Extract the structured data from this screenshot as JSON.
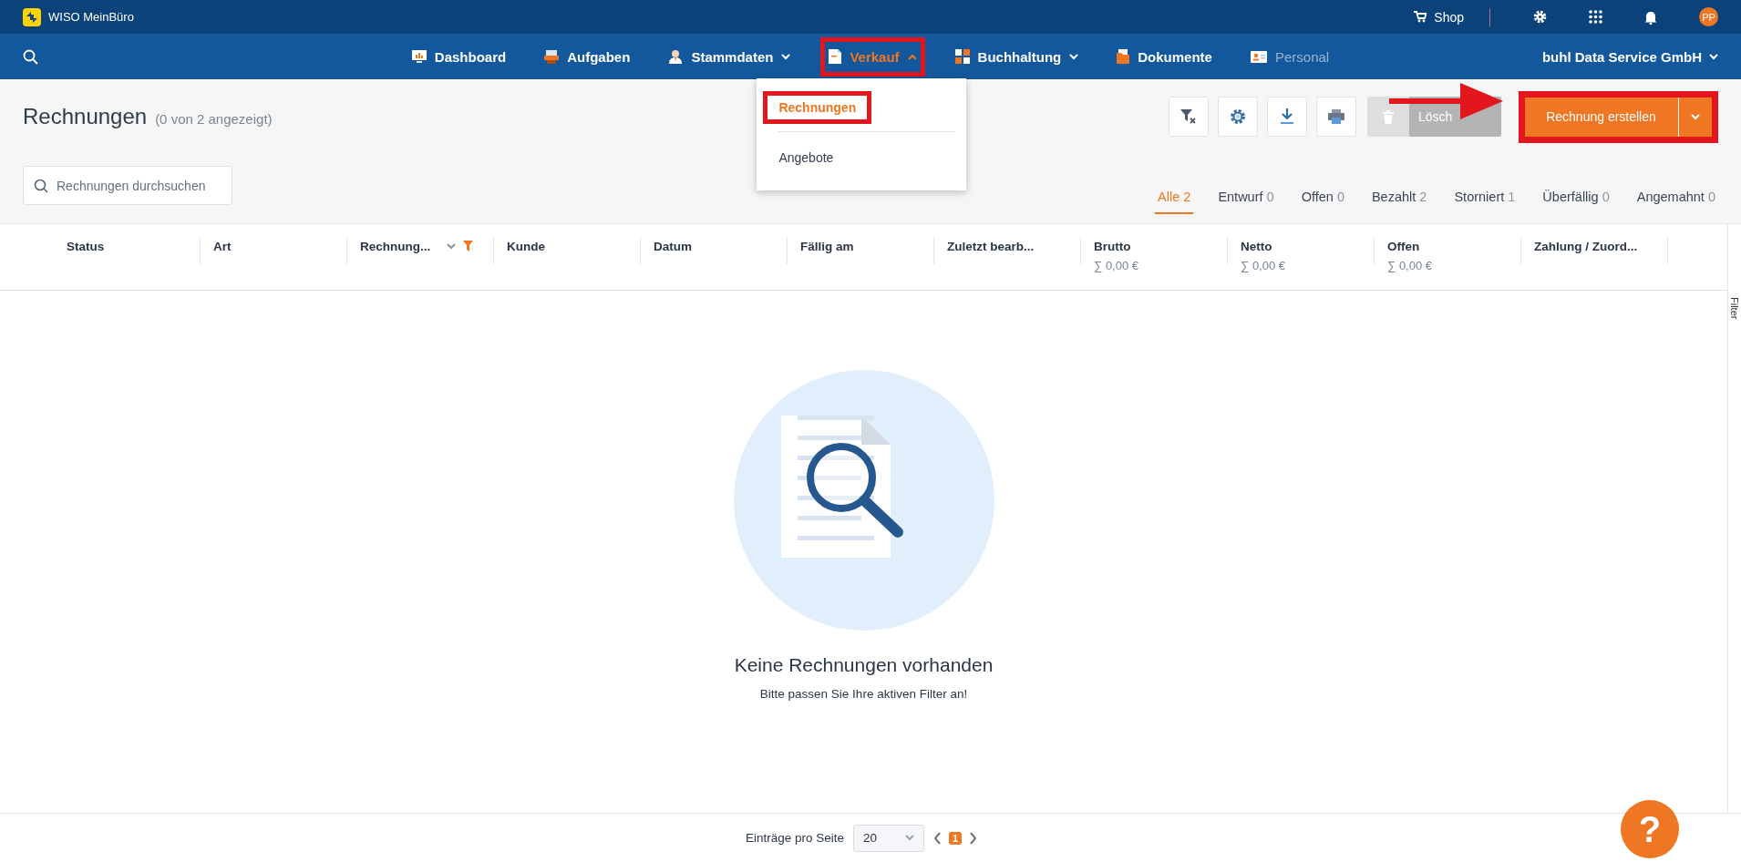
{
  "app": {
    "name": "WISO MeinBüro"
  },
  "topbar": {
    "shop": "Shop",
    "avatar": "PP"
  },
  "nav": {
    "items": [
      {
        "label": "Dashboard",
        "kind": "monitor",
        "dropdown": false,
        "expanded": false,
        "selected": false,
        "disabled": false,
        "highlighted": false
      },
      {
        "label": "Aufgaben",
        "kind": "stack",
        "dropdown": false,
        "expanded": false,
        "selected": false,
        "disabled": false,
        "highlighted": false
      },
      {
        "label": "Stammdaten",
        "kind": "person",
        "dropdown": true,
        "expanded": false,
        "selected": false,
        "disabled": false,
        "highlighted": false
      },
      {
        "label": "Verkauf",
        "kind": "document",
        "dropdown": true,
        "expanded": true,
        "selected": true,
        "disabled": false,
        "highlighted": true
      },
      {
        "label": "Buchhaltung",
        "kind": "grid",
        "dropdown": true,
        "expanded": false,
        "selected": false,
        "disabled": false,
        "highlighted": false
      },
      {
        "label": "Dokumente",
        "kind": "folder",
        "dropdown": false,
        "expanded": false,
        "selected": false,
        "disabled": false,
        "highlighted": false
      },
      {
        "label": "Personal",
        "kind": "idcard",
        "dropdown": false,
        "expanded": false,
        "selected": false,
        "disabled": true,
        "highlighted": false
      }
    ],
    "company": "buhl Data Service GmbH"
  },
  "menu": {
    "items": [
      {
        "label": "Rechnungen",
        "selected": true,
        "highlighted": true
      },
      {
        "label": "Angebote",
        "selected": false,
        "highlighted": false
      }
    ]
  },
  "page": {
    "title": "Rechnungen",
    "count": "(0 von 2 angezeigt)"
  },
  "search": {
    "placeholder": "Rechnungen durchsuchen"
  },
  "toolbar": {
    "tools": [
      {
        "kind": "clear-filter"
      },
      {
        "kind": "settings"
      },
      {
        "kind": "download"
      },
      {
        "kind": "print"
      }
    ],
    "delete": {
      "label": "Lösch",
      "disabled": true
    },
    "create": {
      "label": "Rechnung erstellen",
      "highlighted": true
    },
    "pointer_arrow": true
  },
  "status_tabs": [
    {
      "label": "Alle",
      "count": "2",
      "selected": true
    },
    {
      "label": "Entwurf",
      "count": "0",
      "selected": false
    },
    {
      "label": "Offen",
      "count": "0",
      "selected": false
    },
    {
      "label": "Bezahlt",
      "count": "2",
      "selected": false
    },
    {
      "label": "Storniert",
      "count": "1",
      "selected": false
    },
    {
      "label": "Überfällig",
      "count": "0",
      "selected": false
    },
    {
      "label": "Angemahnt",
      "count": "0",
      "selected": false
    }
  ],
  "table": {
    "columns": [
      {
        "label": "Status"
      },
      {
        "label": "Art"
      },
      {
        "label": "Rechnung...",
        "sorted": true,
        "filtered": true
      },
      {
        "label": "Kunde"
      },
      {
        "label": "Datum"
      },
      {
        "label": "Fällig am"
      },
      {
        "label": "Zuletzt bearb..."
      },
      {
        "label": "Brutto",
        "sum": "∑ 0,00 €"
      },
      {
        "label": "Netto",
        "sum": "∑ 0,00 €"
      },
      {
        "label": "Offen",
        "sum": "∑ 0,00 €"
      },
      {
        "label": "Zahlung / Zuord..."
      }
    ]
  },
  "side_tab": "Filter",
  "empty": {
    "title": "Keine Rechnungen vorhanden",
    "hint": "Bitte passen Sie Ihre aktiven Filter an!"
  },
  "pagination": {
    "label": "Einträge pro Seite",
    "page_size": "20",
    "pages": [
      {
        "label": "1",
        "selected": true
      }
    ]
  },
  "help": "?"
}
